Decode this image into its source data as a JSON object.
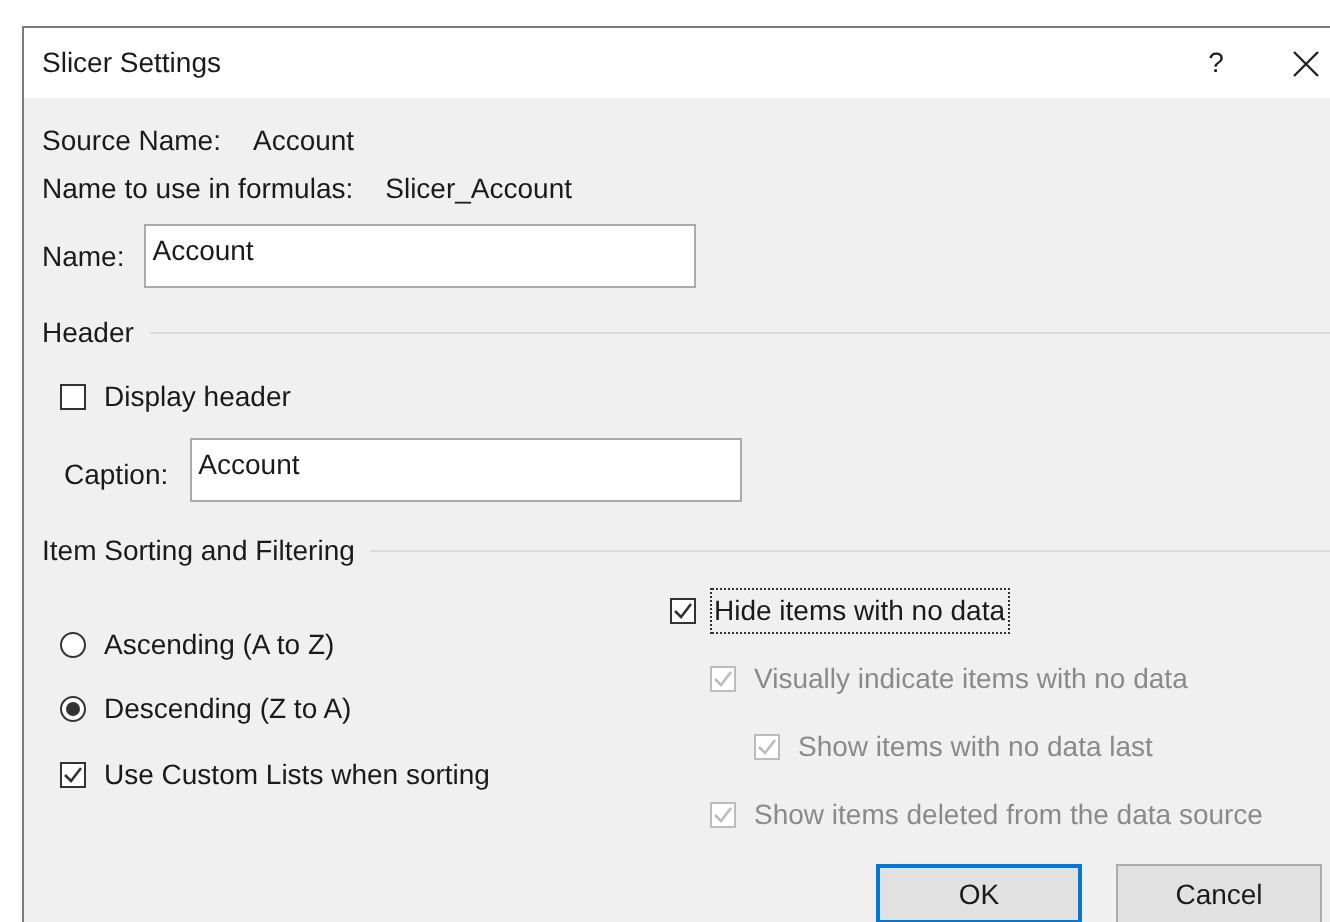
{
  "window": {
    "title": "Slicer Settings",
    "help": "?"
  },
  "source_name": {
    "label": "Source Name:",
    "value": "Account"
  },
  "formula_name": {
    "label": "Name to use in formulas:",
    "value": "Slicer_Account"
  },
  "name_field": {
    "label": "Name:",
    "value": "Account"
  },
  "header": {
    "title": "Header",
    "display_header": {
      "label": "Display header",
      "checked": false
    },
    "caption": {
      "label": "Caption:",
      "value": "Account"
    }
  },
  "sorting": {
    "title": "Item Sorting and Filtering",
    "options": [
      {
        "label": "Ascending (A to Z)",
        "selected": false
      },
      {
        "label": "Descending (Z to A)",
        "selected": true
      }
    ],
    "custom_lists": {
      "label": "Use Custom Lists when sorting",
      "checked": true
    }
  },
  "filtering": [
    {
      "label": "Hide items with no data",
      "checked": true,
      "disabled": false,
      "focused": true,
      "children": [
        {
          "label": "Visually indicate items with no data",
          "checked": true,
          "disabled": true,
          "focused": false,
          "children": [
            {
              "label": "Show items with no data last",
              "checked": true,
              "disabled": true,
              "focused": false
            }
          ]
        },
        {
          "label": "Show items deleted from the data source",
          "checked": true,
          "disabled": true,
          "focused": false
        }
      ]
    }
  ],
  "buttons": [
    {
      "label": "OK",
      "kind": "default"
    },
    {
      "label": "Cancel",
      "kind": "normal"
    }
  ]
}
